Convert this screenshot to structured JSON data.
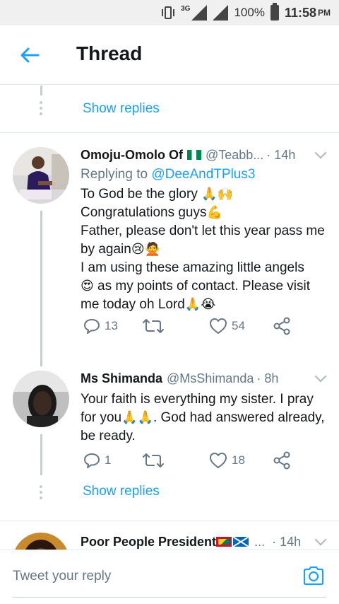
{
  "status_bar": {
    "network": "3G",
    "battery": "100%",
    "time": "11:58",
    "ampm": "PM"
  },
  "header": {
    "title": "Thread"
  },
  "show_replies_label": "Show replies",
  "tweets": [
    {
      "name": "Omoju-Omolo Of",
      "handle": "@Teabb...",
      "time": "· 14h",
      "replying_prefix": "Replying to",
      "replying_to": "@DeeAndTPlus3",
      "lines": [
        "To God be the glory",
        "Congratulations guys",
        "Father, please don't let this year pass me",
        "by again",
        "I am using these amazing little angels",
        "as my points of contact. Please visit",
        "me today oh Lord"
      ],
      "replies": "13",
      "retweets": "",
      "likes": "54"
    },
    {
      "name": "Ms Shimanda",
      "handle": "@MsShimanda",
      "time": "· 8h",
      "lines": [
        "Your faith is everything my sister. I pray",
        "for you",
        ". God had answered already,",
        "be ready."
      ],
      "replies": "1",
      "retweets": "",
      "likes": "18"
    },
    {
      "name": "Poor People President",
      "handle": "...",
      "time": "· 14h"
    }
  ],
  "reply_bar": {
    "placeholder": "Tweet your reply"
  },
  "colors": {
    "accent": "#1da1f2",
    "muted": "#657786",
    "divider": "#e1e8ed"
  }
}
